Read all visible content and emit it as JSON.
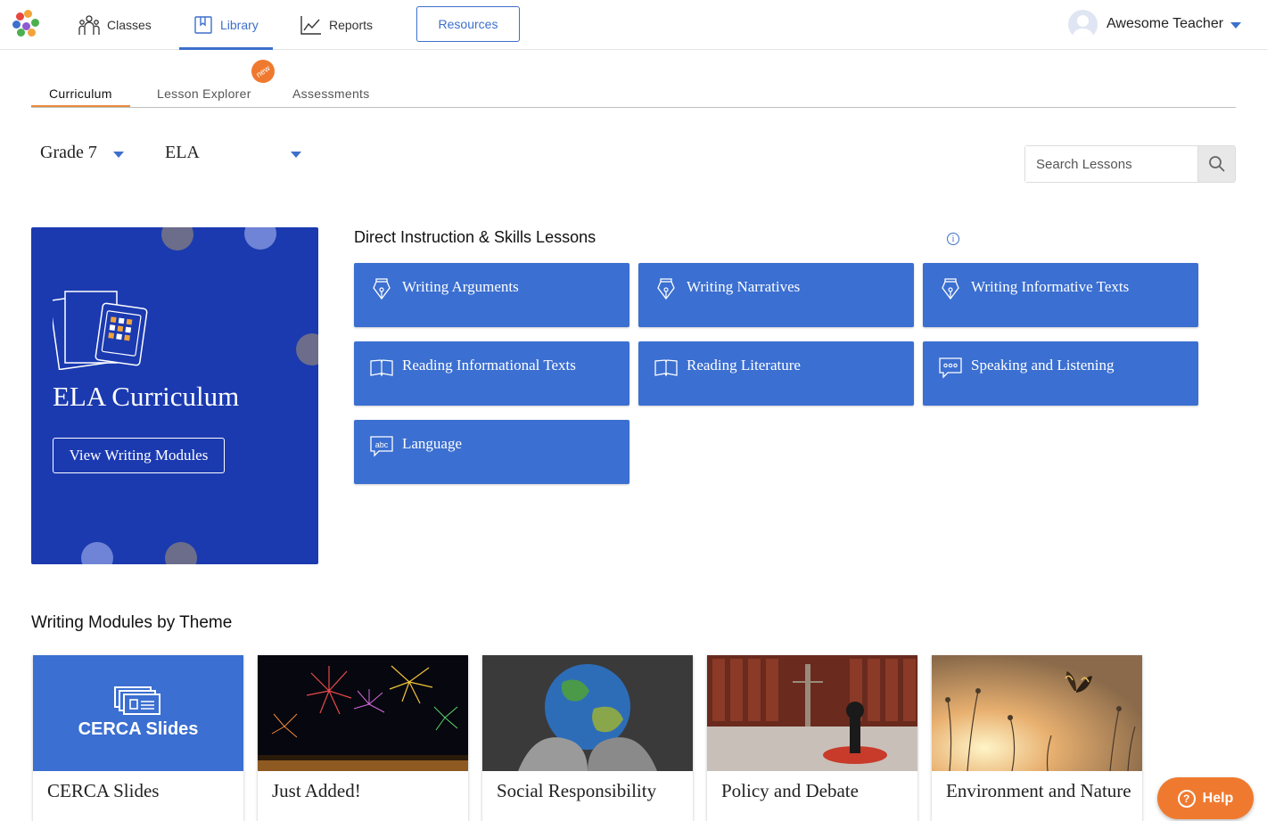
{
  "nav": {
    "classes": "Classes",
    "library": "Library",
    "reports": "Reports",
    "resources": "Resources",
    "user_name": "Awesome Teacher",
    "logo_colors": [
      "#e8473f",
      "#3d6fcc",
      "#f2a33a",
      "#4caf50",
      "#8e5bd1"
    ]
  },
  "subtabs": {
    "curriculum": "Curriculum",
    "lesson_explorer": "Lesson Explorer",
    "assessments": "Assessments",
    "new_badge": "new"
  },
  "filters": {
    "grade": "Grade 7",
    "subject": "ELA",
    "search_placeholder": "Search Lessons"
  },
  "ela_card": {
    "title": "ELA Curriculum",
    "button": "View Writing Modules",
    "bg_color": "#1b3ab0"
  },
  "direct_instruction": {
    "title": "Direct Instruction & Skills Lessons",
    "info": "i",
    "tiles": [
      {
        "label": "Writing Arguments",
        "icon": "pen-nib-icon"
      },
      {
        "label": "Writing Narratives",
        "icon": "pen-nib-icon"
      },
      {
        "label": "Writing Informative Texts",
        "icon": "pen-nib-icon"
      },
      {
        "label": "Reading Informational Texts",
        "icon": "open-book-icon"
      },
      {
        "label": "Reading Literature",
        "icon": "open-book-icon"
      },
      {
        "label": "Speaking and Listening",
        "icon": "speech-bubble-icon"
      },
      {
        "label": "Language",
        "icon": "abc-icon"
      }
    ]
  },
  "writing_modules": {
    "title": "Writing Modules by Theme",
    "cerca_logo_text": "CERCA Slides",
    "cards": [
      {
        "label": "CERCA Slides"
      },
      {
        "label": "Just Added!"
      },
      {
        "label": "Social Responsibility"
      },
      {
        "label": "Policy and Debate"
      },
      {
        "label": "Environment and Nature"
      }
    ]
  },
  "help": {
    "label": "Help",
    "icon_text": "?"
  }
}
